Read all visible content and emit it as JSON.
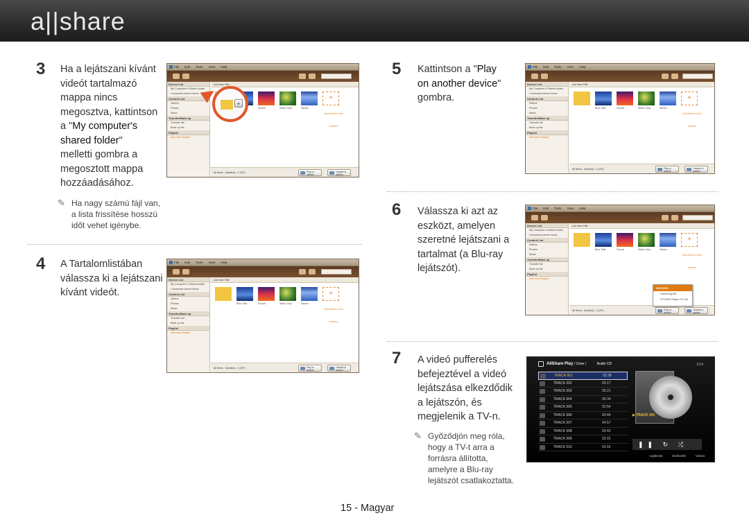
{
  "header": {
    "logo": "a||share"
  },
  "steps": {
    "s3": {
      "num": "3",
      "lines": [
        "Ha a lejátszani kívánt",
        "videót tartalmazó",
        "mappa nincs",
        "megosztva, kattintson"
      ],
      "line5_pre": "a \"",
      "line5_b": "My computer's",
      "line6_b": "shared folder",
      "line6_post": "\"",
      "lines_after": [
        "melletti gombra a",
        "megosztott mappa",
        "hozzáadásához."
      ]
    },
    "note3": [
      "Ha nagy számú fájl van,",
      "a lista frissítése hosszú",
      "időt vehet igénybe."
    ],
    "s4": {
      "num": "4",
      "lines": [
        "A Tartalomlistában",
        "válassza ki a lejátszani",
        "kívánt videót."
      ]
    },
    "s5": {
      "num": "5",
      "line1_pre": "Kattintson a \"",
      "line1_b": "Play",
      "line2_b": "on another device",
      "line2_post": "\"",
      "line3": "gombra."
    },
    "s6": {
      "num": "6",
      "lines": [
        "Válassza ki azt az",
        "eszközt, amelyen",
        "szeretné lejátszani a",
        "tartalmat (a Blu-ray",
        "lejátszót)."
      ]
    },
    "s7": {
      "num": "7",
      "lines": [
        "A videó pufferelés",
        "befejeztével a videó",
        "lejátszása elkezdődik",
        "a lejátszón, és",
        "megjelenik a TV-n."
      ]
    },
    "note7": [
      "Győződjön meg róla,",
      "hogy a TV-t arra a",
      "forrásra állította,",
      "amelyre a Blu-ray",
      "lejátszót csatlakoztatta."
    ]
  },
  "app": {
    "menu": [
      "File",
      "Edit",
      "Tools",
      "View",
      "Help"
    ],
    "sidebar_head1": "Device List",
    "my_shared": "My Computer's Shared folder",
    "connected": "Connected device items",
    "content_list": "Content List",
    "videos": "Videos",
    "photos": "Photos",
    "music": "Music",
    "transfer": "Transfer/Back up",
    "transfer_list": "Transfer list",
    "backup_list": "Back up list",
    "playlist": "Playlist",
    "add_new": "Add new Playlist",
    "cbar": "List view  Title",
    "thumbs": [
      "Blue Tails",
      "Sunset",
      "Water Drop",
      "Waves"
    ],
    "add_label": "Add Media to this location",
    "status": "All Items : 4(videos) ; 2 (GP) ;",
    "btn_play": "Play on another device",
    "btn_transfer": "Transfer to another device",
    "popup_head": "DEVICES",
    "popup_items": [
      "Samsung BD",
      "DTV/BD Player PC etc"
    ]
  },
  "tv": {
    "title": "AllShare Play",
    "subtitle": "/ Zone /",
    "source": "Audio CD",
    "count": "1/14",
    "tracks": [
      {
        "name": "TRACK 001",
        "time": "02:38"
      },
      {
        "name": "TRACK 002",
        "time": "03:17"
      },
      {
        "name": "TRACK 003",
        "time": "05:21"
      },
      {
        "name": "TRACK 004",
        "time": "05:34"
      },
      {
        "name": "TRACK 005",
        "time": "02:54"
      },
      {
        "name": "TRACK 006",
        "time": "03:44"
      },
      {
        "name": "TRACK 007",
        "time": "04:57"
      },
      {
        "name": "TRACK 008",
        "time": "03:42"
      },
      {
        "name": "TRACK 009",
        "time": "03:15"
      },
      {
        "name": "TRACK 010",
        "time": "03:16"
      }
    ],
    "now_playing": "▶ TRACK 001",
    "controls": "❚❚ ↻ ⤮",
    "footer": [
      "Lejátszás",
      "Eszközök",
      "Vissza"
    ]
  },
  "footer": {
    "page": "15 - Magyar"
  }
}
